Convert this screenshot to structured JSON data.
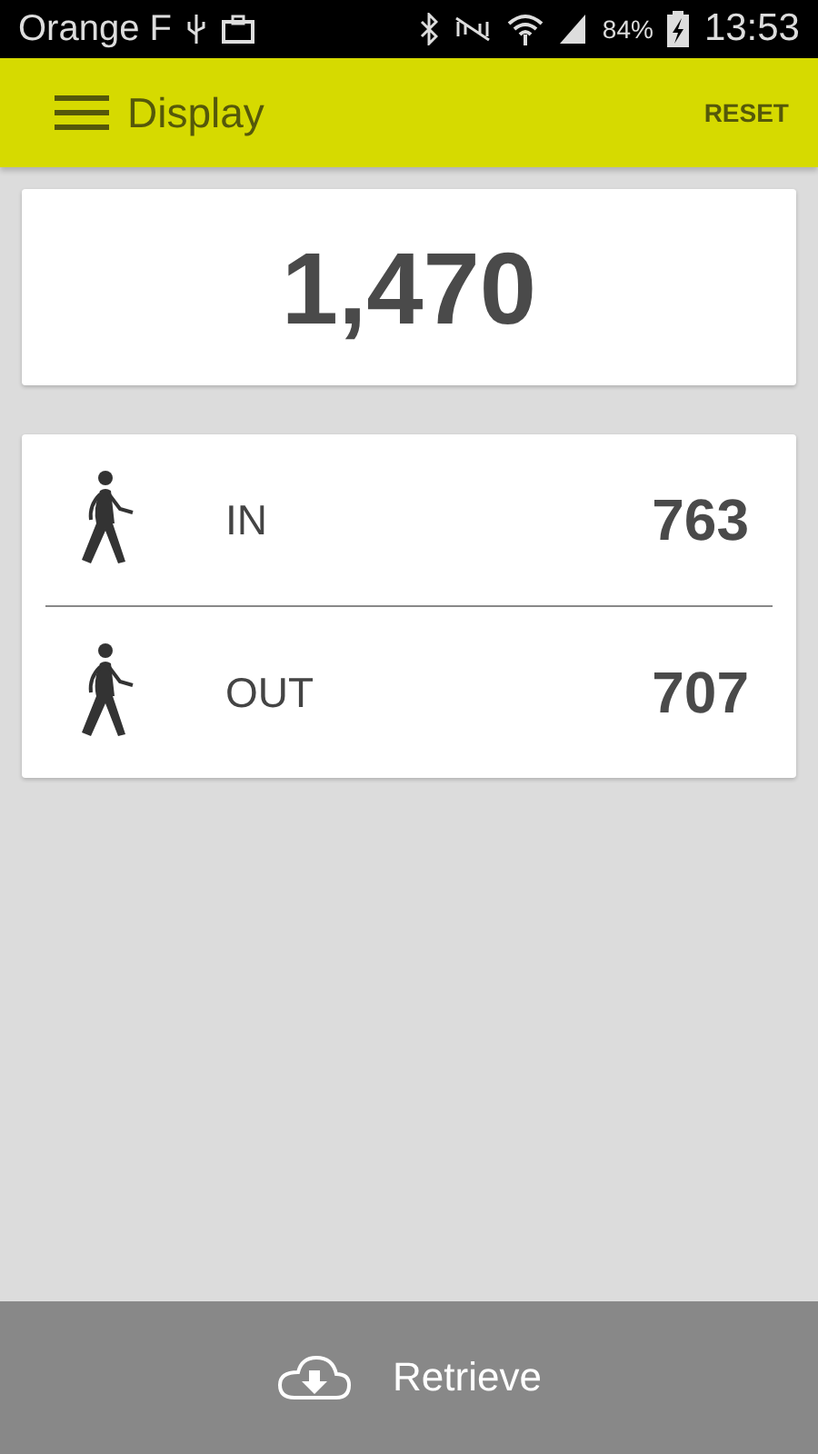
{
  "status_bar": {
    "carrier": "Orange F",
    "battery": "84%",
    "time": "13:53"
  },
  "app_bar": {
    "title": "Display",
    "action": "RESET"
  },
  "total": "1,470",
  "counters": [
    {
      "label": "IN",
      "value": "763"
    },
    {
      "label": "OUT",
      "value": "707"
    }
  ],
  "bottom_button": {
    "label": "Retrieve"
  }
}
